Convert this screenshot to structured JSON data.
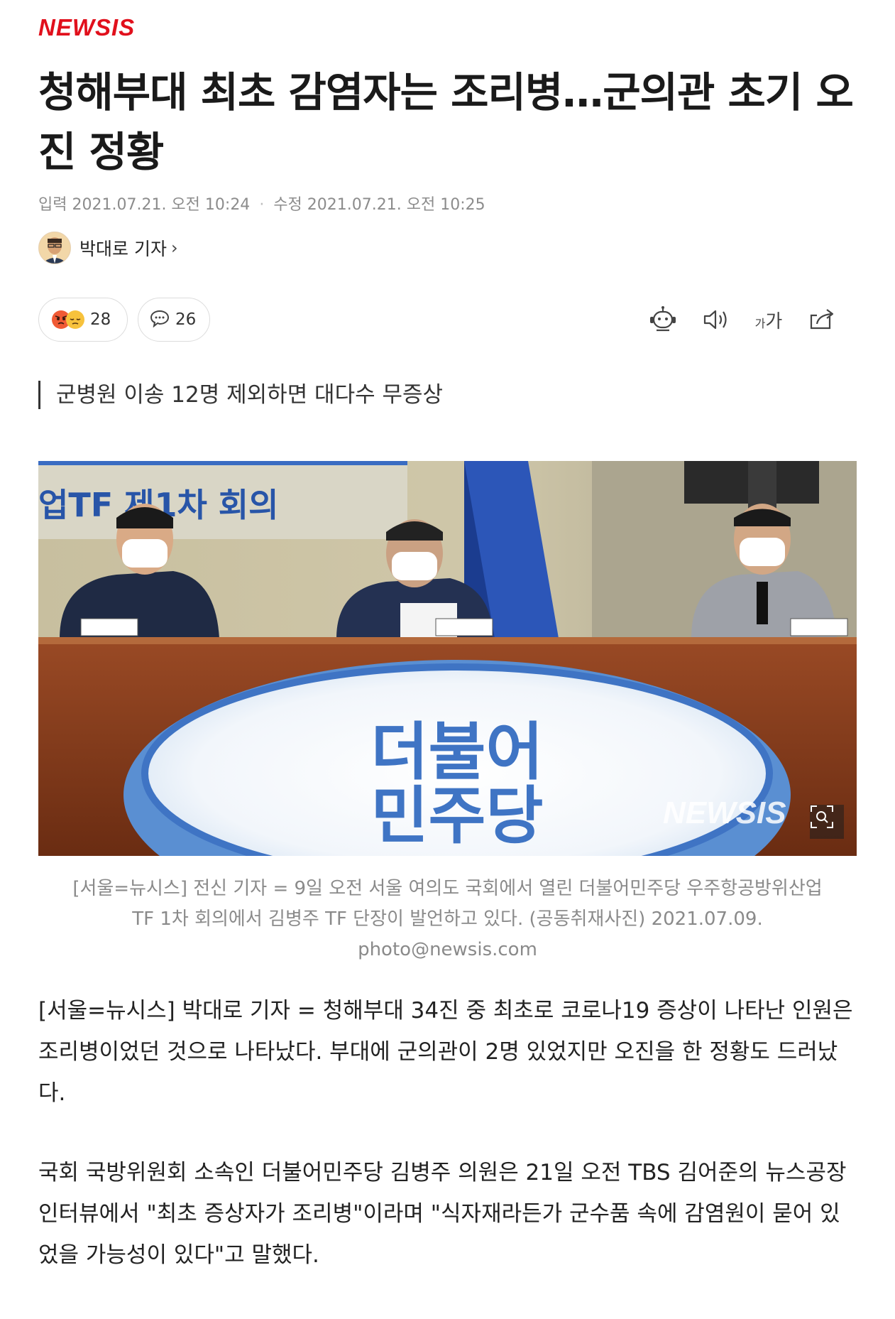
{
  "brand": {
    "logo_text": "NEWSIS",
    "color": "#e1101c"
  },
  "article": {
    "title": "청해부대 최초 감염자는 조리병…군의관 초기 오진 정황",
    "input_label": "입력",
    "input_date": "2021.07.21. 오전 10:24",
    "modified_label": "수정",
    "modified_date": "2021.07.21. 오전 10:25",
    "separator": "·",
    "reporter": {
      "name": "박대로 기자",
      "chevron": "›"
    },
    "subhead": "군병원 이송 12명 제외하면 대다수 무증상",
    "reactions": {
      "count": "28",
      "icons": [
        "angry-face-icon",
        "sad-face-icon"
      ]
    },
    "comments": {
      "count": "26",
      "icon": "comment-bubble-icon"
    },
    "tools": [
      {
        "name": "ai-summary-bot-icon"
      },
      {
        "name": "text-to-speech-icon"
      },
      {
        "name": "font-size-icon",
        "label": "가"
      },
      {
        "name": "share-icon"
      }
    ],
    "photo": {
      "banner_text": "업TF 제1차 회의",
      "podium_line1": "더불어",
      "podium_line2": "민주당",
      "watermark": "NEWSIS",
      "zoom_icon": "zoom-icon"
    },
    "caption_lines": [
      "[서울=뉴시스] 전신 기자 = 9일 오전 서울 여의도 국회에서 열린 더불어민주당 우주항공방위산업",
      "TF 1차 회의에서 김병주 TF 단장이 발언하고 있다. (공동취재사진) 2021.07.09.",
      "photo@newsis.com"
    ],
    "paragraphs": [
      "[서울=뉴시스] 박대로 기자 = 청해부대 34진 중 최초로 코로나19 증상이 나타난 인원은 조리병이었던 것으로 나타났다. 부대에 군의관이 2명 있었지만 오진을 한 정황도 드러났다.",
      "국회 국방위원회 소속인 더불어민주당 김병주 의원은 21일 오전 TBS 김어준의 뉴스공장 인터뷰에서 \"최초 증상자가 조리병\"이라며 \"식자재라든가 군수품 속에 감염원이 묻어 있었을 가능성이 있다\"고 말했다."
    ]
  }
}
